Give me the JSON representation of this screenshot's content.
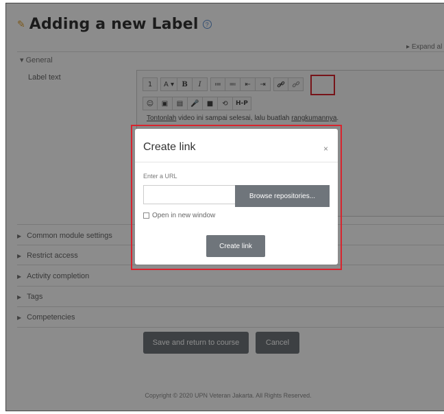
{
  "page": {
    "title": "Adding a new Label",
    "expand_all": "Expand al",
    "section_general": "General",
    "label_text": "Label text"
  },
  "editor": {
    "toolbar_row1": [
      "1",
      "A ▾",
      "B",
      "I",
      "≔",
      "≕",
      "⇤",
      "⇥",
      "link",
      "unlink"
    ],
    "toolbar_row2": [
      "☺",
      "▣",
      "▤",
      "🎤",
      "■",
      "⟲",
      "H-P"
    ],
    "content": {
      "part1": "Tontonlah",
      "part2": " video ini sampai selesai, lalu buatlah ",
      "part3": "rangkumannya",
      "part4": "."
    }
  },
  "sections": [
    "Common module settings",
    "Restrict access",
    "Activity completion",
    "Tags",
    "Competencies"
  ],
  "buttons": {
    "save": "Save and return to course",
    "cancel": "Cancel"
  },
  "footer": "Copyright © 2020 UPN Veteran Jakarta. All Rights Reserved.",
  "dialog": {
    "title": "Create link",
    "close": "×",
    "enter_url_label": "Enter a URL",
    "url_value": "",
    "browse_button": "Browse repositories...",
    "open_new_window": "Open in new window",
    "create_button": "Create link"
  },
  "colors": {
    "highlight": "#d9232d",
    "button": "#6f757b"
  }
}
